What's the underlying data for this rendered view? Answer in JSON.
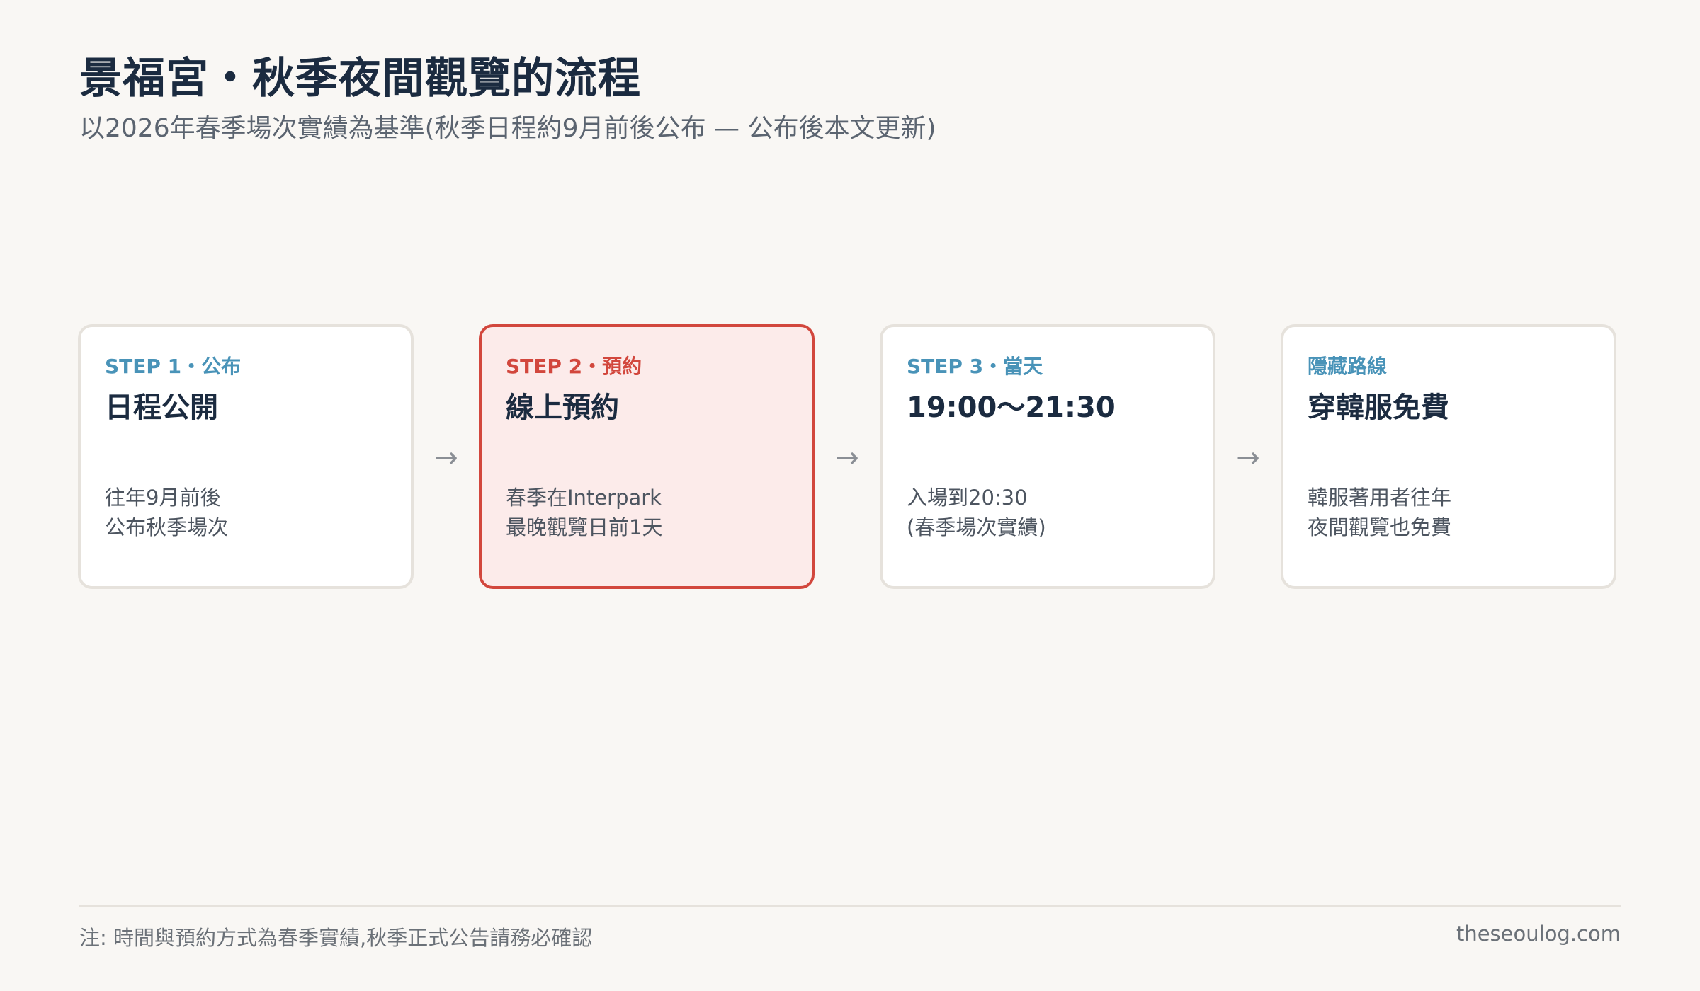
{
  "title": "景福宮・秋季夜間觀覽的流程",
  "subtitle": "以2026年春季場次實績為基準(秋季日程約9月前後公布 — 公布後本文更新)",
  "steps": [
    {
      "label": "STEP 1・公布",
      "title": "日程公開",
      "desc": [
        "往年9月前後",
        "公布秋季場次"
      ]
    },
    {
      "label": "STEP 2・預約",
      "title": "線上預約",
      "desc": [
        "春季在Interpark",
        "最晚觀覽日前1天"
      ]
    },
    {
      "label": "STEP 3・當天",
      "title": "19:00〜21:30",
      "desc": [
        "入場到20:30",
        "(春季場次實績)"
      ]
    },
    {
      "label": "隱藏路線",
      "title": "穿韓服免費",
      "desc": [
        "韓服著用者往年",
        "夜間觀覽也免費"
      ]
    }
  ],
  "arrow_glyph": "→",
  "footer": {
    "note": "注: 時間與預約方式為春季實績,秋季正式公告請務必確認",
    "site": "theseoulog.com"
  },
  "colors": {
    "background": "#f9f7f4",
    "accent_blue": "#4993b8",
    "accent_red": "#d2473d",
    "highlight_fill": "#fcebea",
    "title_navy": "#1b2b40"
  }
}
